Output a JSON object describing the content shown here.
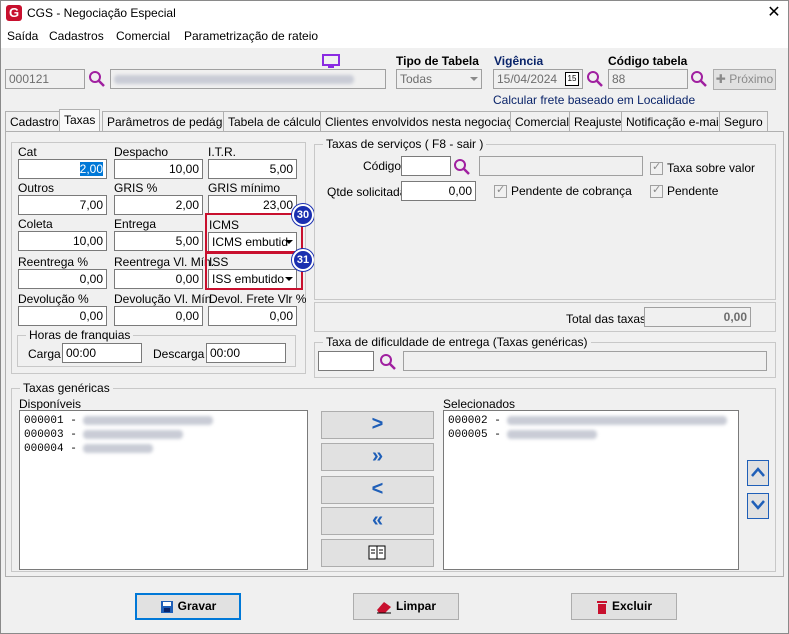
{
  "window": {
    "title": "CGS - Negociação Especial",
    "logo_letter": "G"
  },
  "menu": [
    "Saída",
    "Cadastros",
    "Comercial",
    "Parametrização de rateio"
  ],
  "header": {
    "code_value": "000121",
    "tipo_tabela_label": "Tipo de Tabela",
    "tipo_tabela_value": "Todas",
    "vigencia_label": "Vigência",
    "vigencia_value": "15/04/2024",
    "vigencia_icon_text": "15",
    "codigo_tabela_label": "Código tabela",
    "codigo_tabela_value": "88",
    "proximo_label": "Próximo",
    "calcular_link": "Calcular frete baseado em Localidade"
  },
  "tabs": [
    "Cadastro",
    "Taxas",
    "Parâmetros de pedágio",
    "Tabela de cálculo",
    "Clientes envolvidos nesta negociação",
    "Comercial",
    "Reajuste",
    "Notificação e-mail",
    "Seguro"
  ],
  "taxas": {
    "cat": {
      "label": "Cat",
      "value": "2,00"
    },
    "despacho": {
      "label": "Despacho",
      "value": "10,00"
    },
    "itr": {
      "label": "I.T.R.",
      "value": "5,00"
    },
    "outros": {
      "label": "Outros",
      "value": "7,00"
    },
    "gris_pct": {
      "label": "GRIS %",
      "value": "2,00"
    },
    "gris_min": {
      "label": "GRIS mínimo",
      "value": "23,00"
    },
    "coleta": {
      "label": "Coleta",
      "value": "10,00"
    },
    "entrega": {
      "label": "Entrega",
      "value": "5,00"
    },
    "icms": {
      "label": "ICMS",
      "value": "ICMS embutid"
    },
    "reentrega_pct": {
      "label": "Reentrega %",
      "value": "0,00"
    },
    "reentrega_min": {
      "label": "Reentrega Vl. Mín.",
      "value": "0,00"
    },
    "iss": {
      "label": "ISS",
      "value": "ISS embutido"
    },
    "devolucao_pct": {
      "label": "Devolução %",
      "value": "0,00"
    },
    "devolucao_min": {
      "label": "Devolução Vl. Mín.",
      "value": "0,00"
    },
    "devol_frete": {
      "label": "Devol. Frete Vlr %",
      "value": "0,00"
    },
    "franquias_title": "Horas de franquias",
    "carga_label": "Carga",
    "carga_value": "00:00",
    "descarga_label": "Descarga",
    "descarga_value": "00:00",
    "badge_icms": "30",
    "badge_iss": "31"
  },
  "servicos": {
    "title": "Taxas de serviços  ( F8 - sair )",
    "codigo_label": "Código",
    "qtde_label": "Qtde solicitada",
    "qtde_value": "0,00",
    "taxa_sobre_valor": "Taxa sobre valor",
    "pendente_cobranca": "Pendente de cobrança",
    "pendente": "Pendente",
    "total_label": "Total das taxas",
    "total_value": "0,00"
  },
  "dificuldade": {
    "title": "Taxa de dificuldade de entrega (Taxas genéricas)"
  },
  "genericas": {
    "title": "Taxas genéricas",
    "disponiveis_label": "Disponíveis",
    "selecionados_label": "Selecionados",
    "disponiveis": [
      "000001 -",
      "000003 -",
      "000004 -"
    ],
    "selecionados": [
      "000002 -",
      "000005 -"
    ],
    "move_buttons": [
      ">",
      "»",
      "<",
      "«"
    ]
  },
  "footer": {
    "gravar": "Gravar",
    "limpar": "Limpar",
    "excluir": "Excluir"
  },
  "colors": {
    "accent_blue": "#1f5fb8",
    "highlight_red": "#c8102e",
    "badge_blue": "#1a2fb0",
    "link_blue": "#0a246a"
  }
}
